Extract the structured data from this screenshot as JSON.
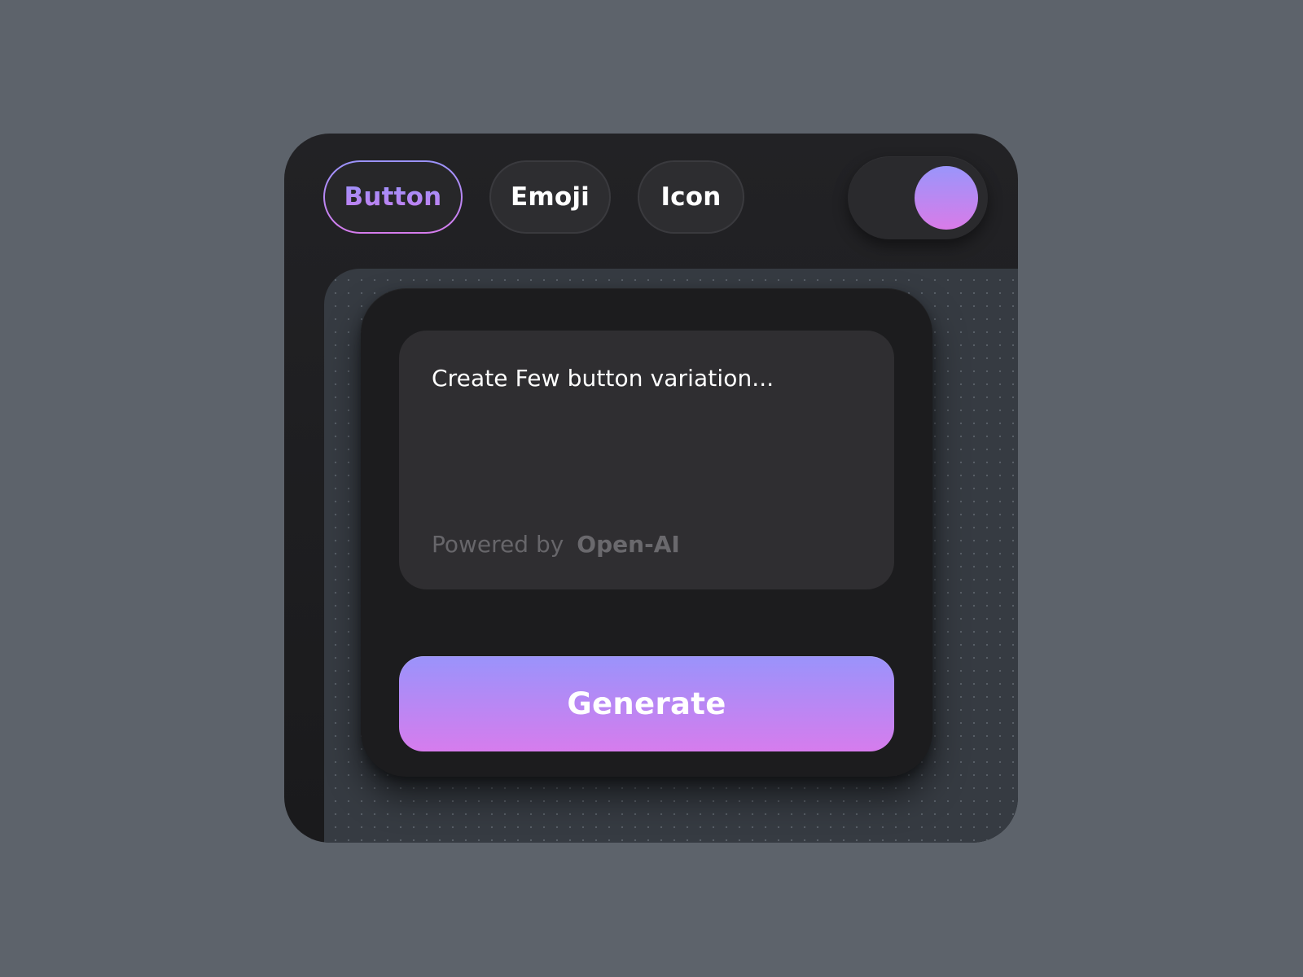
{
  "tabs": {
    "button_label": "Button",
    "emoji_label": "Emoji",
    "icon_label": "Icon",
    "active": "Button"
  },
  "toggle": {
    "state": "on"
  },
  "prompt": {
    "text": "Create Few button variation...",
    "powered_by_label": "Powered by",
    "powered_by_brand": "Open-AI"
  },
  "actions": {
    "generate_label": "Generate"
  },
  "colors": {
    "background": "#5d636b",
    "panel": "#1c1c1e",
    "accent_start": "#9a93fb",
    "accent_end": "#d67ced"
  }
}
